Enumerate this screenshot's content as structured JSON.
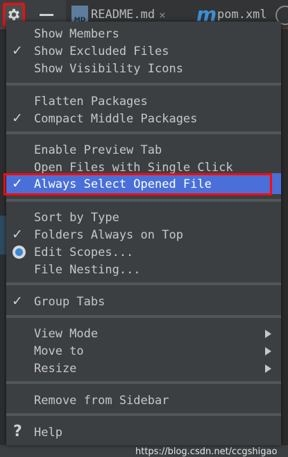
{
  "tabs": {
    "readme": {
      "label": "README.md",
      "icon_text": "MD",
      "icon": "markdown-file-icon"
    },
    "pom": {
      "label": "pom.xml",
      "icon_text": "m",
      "icon": "maven-file-icon"
    },
    "close_glyph": "×"
  },
  "menu": {
    "groups": [
      [
        {
          "id": "show-members",
          "label": "Show Members",
          "checked": false
        },
        {
          "id": "show-excluded-files",
          "label": "Show Excluded Files",
          "checked": true
        },
        {
          "id": "show-visibility-icons",
          "label": "Show Visibility Icons",
          "checked": false
        }
      ],
      [
        {
          "id": "flatten-packages",
          "label": "Flatten Packages",
          "checked": false
        },
        {
          "id": "compact-middle-packages",
          "label": "Compact Middle Packages",
          "checked": true
        }
      ],
      [
        {
          "id": "enable-preview-tab",
          "label": "Enable Preview Tab",
          "checked": false
        },
        {
          "id": "open-files-single-click",
          "label": "Open Files with Single Click",
          "checked": false
        },
        {
          "id": "always-select-opened-file",
          "label": "Always Select Opened File",
          "checked": true,
          "selected": true
        }
      ],
      [
        {
          "id": "sort-by-type",
          "label": "Sort by Type",
          "checked": false
        },
        {
          "id": "folders-always-on-top",
          "label": "Folders Always on Top",
          "checked": true
        },
        {
          "id": "edit-scopes",
          "label": "Edit Scopes...",
          "radio": true
        },
        {
          "id": "file-nesting",
          "label": "File Nesting...",
          "checked": false
        }
      ],
      [
        {
          "id": "group-tabs",
          "label": "Group Tabs",
          "checked": true
        }
      ],
      [
        {
          "id": "view-mode",
          "label": "View Mode",
          "submenu": true
        },
        {
          "id": "move-to",
          "label": "Move to",
          "submenu": true
        },
        {
          "id": "resize",
          "label": "Resize",
          "submenu": true
        }
      ],
      [
        {
          "id": "remove-from-sidebar",
          "label": "Remove from Sidebar"
        }
      ],
      [
        {
          "id": "help",
          "label": "Help",
          "icon": "help-icon",
          "icon_glyph": "?"
        }
      ]
    ],
    "check_glyph": "✓"
  },
  "watermark": "https://blog.csdn.net/ccgshigao",
  "colors": {
    "highlight": "#4a6fd8",
    "annotation_red": "#ff0a0a",
    "background": "#3c3f41",
    "separator": "#515658",
    "radio_accent": "#3b87d8"
  },
  "icons": {
    "settings": "gear-icon",
    "minimize": "minimize-icon"
  }
}
